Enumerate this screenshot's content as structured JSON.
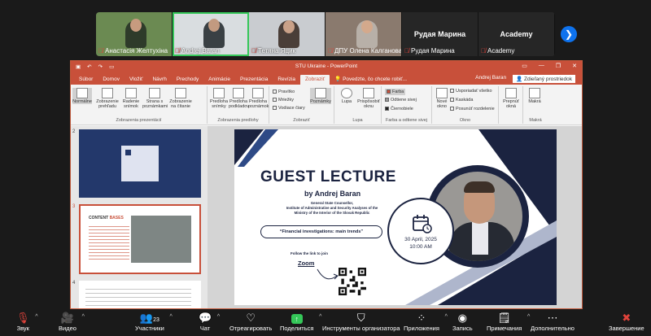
{
  "gallery": {
    "participants": [
      {
        "name": "Анастасія Желтухіна",
        "muted": true
      },
      {
        "name": "Andrej Baran",
        "muted": true,
        "active": true
      },
      {
        "name": "Тетяна Яцик",
        "muted": true
      },
      {
        "name": "ДПУ Олена Калганова",
        "muted": true
      },
      {
        "name": "Рудая Марина",
        "muted": true,
        "big_label": "Рудая Марина"
      },
      {
        "name": "Academy",
        "muted": true,
        "big_label": "Academy"
      }
    ]
  },
  "ppt": {
    "window_title": "STU Ukraine - PowerPoint",
    "user": "Andrej Baran",
    "share_label": "Zdieľaný prostriedok",
    "tabs": [
      "Súbor",
      "Domov",
      "Vložiť",
      "Návrh",
      "Prechody",
      "Animácie",
      "Prezentácia",
      "Revízia",
      "Zobraziť"
    ],
    "active_tab": "Zobraziť",
    "tell_me": "Povedzte, čo chcete robiť...",
    "ribbon": {
      "groups": [
        {
          "label": "Zobrazenia prezentácií",
          "buttons": [
            "Normálne",
            "Zobrazenie prehľadu",
            "Radenie snímok",
            "Strana s poznámkami",
            "Zobrazenie na čítanie"
          ]
        },
        {
          "label": "Zobrazenia predlohy",
          "buttons": [
            "Predloha snímky",
            "Predloha podkladov",
            "Predloha poznámok"
          ]
        },
        {
          "label": "Zobraziť",
          "checks": [
            "Pravítko",
            "Mriežky",
            "Vodiace čiary"
          ],
          "buttons": [
            "Poznámky"
          ]
        },
        {
          "label": "Lupa",
          "buttons": [
            "Lupa",
            "Prispôsobiť oknu"
          ]
        },
        {
          "label": "Farba a odtiene sivej",
          "items": [
            "Farba",
            "Odtiene sivej",
            "Čiernobiele"
          ]
        },
        {
          "label": "Okno",
          "buttons": [
            "Nové okno"
          ],
          "items": [
            "Usporiadať všetko",
            "Kaskáda",
            "Posunúť rozdelenie"
          ]
        },
        {
          "label": "",
          "buttons": [
            "Prepnúť okná"
          ]
        },
        {
          "label": "Makrá",
          "buttons": [
            "Makrá"
          ]
        }
      ]
    },
    "thumbnails": [
      {
        "number": "2"
      },
      {
        "number": "3",
        "title": "CONTENT",
        "subtitle": "BASES"
      },
      {
        "number": "4"
      }
    ],
    "slide": {
      "title": "GUEST LECTURE",
      "byline": "by Andrej Baran",
      "role_lines": [
        "General State Counsellor,",
        "Institute of Administrative and Security Analyses of the",
        "Ministry of the Interior of the Slovak Republic"
      ],
      "topic": "“Financial investigations: main trends”",
      "follow_text": "Follow the link to join",
      "zoom_link": "Zoom",
      "date": "30 April, 2025",
      "time": "10:00 AM"
    }
  },
  "toolbar": {
    "items": [
      {
        "label": "Звук",
        "icon": "mic-off-icon"
      },
      {
        "label": "Видео",
        "icon": "video-off-icon"
      },
      {
        "label": "Участники",
        "icon": "participants-icon",
        "count": "23"
      },
      {
        "label": "Чат",
        "icon": "chat-icon"
      },
      {
        "label": "Отреагировать",
        "icon": "heart-icon"
      },
      {
        "label": "Поделиться",
        "icon": "share-screen-icon"
      },
      {
        "label": "Инструменты организатора",
        "icon": "shield-icon"
      },
      {
        "label": "Приложения",
        "icon": "apps-icon"
      },
      {
        "label": "Запись",
        "icon": "record-icon"
      },
      {
        "label": "Примечания",
        "icon": "notes-icon"
      },
      {
        "label": "Дополнительно",
        "icon": "more-icon"
      },
      {
        "label": "Завершение",
        "icon": "end-icon"
      }
    ]
  },
  "colors": {
    "accent": "#c8503a",
    "navy": "#1b2340",
    "zoom_green": "#35c759",
    "end_red": "#e0433b"
  }
}
